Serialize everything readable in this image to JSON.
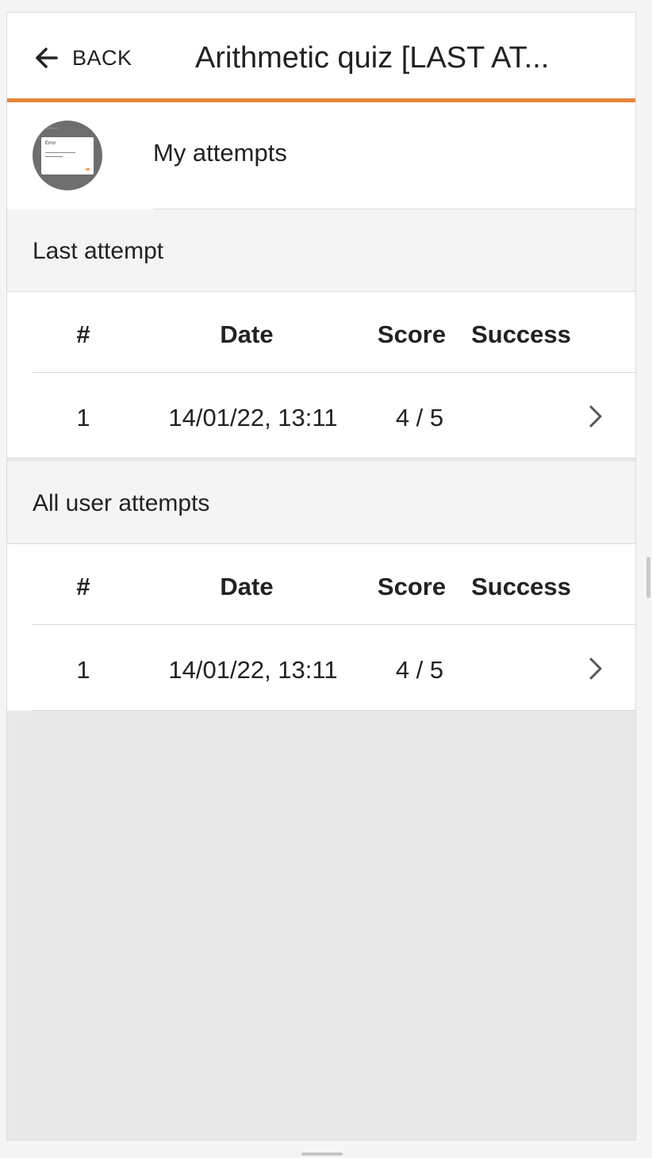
{
  "header": {
    "back_label": "BACK",
    "title": "Arithmetic quiz [LAST AT..."
  },
  "attempts_item": {
    "label": "My attempts",
    "thumbnail_text": "Error"
  },
  "sections": [
    {
      "title": "Last attempt",
      "columns": [
        "#",
        "Date",
        "Score",
        "Success"
      ],
      "rows": [
        {
          "num": "1",
          "date": "14/01/22, 13:11",
          "score": "4 / 5",
          "success": ""
        }
      ]
    },
    {
      "title": "All user attempts",
      "columns": [
        "#",
        "Date",
        "Score",
        "Success"
      ],
      "rows": [
        {
          "num": "1",
          "date": "14/01/22, 13:11",
          "score": "4 / 5",
          "success": ""
        }
      ]
    }
  ],
  "icons": {
    "back": "arrow-left-icon",
    "row_open": "chevron-right-icon"
  },
  "colors": {
    "accent": "#e8843a",
    "panel_background": "#e8e8e8",
    "section_background": "#f4f4f4",
    "text": "#222222"
  }
}
